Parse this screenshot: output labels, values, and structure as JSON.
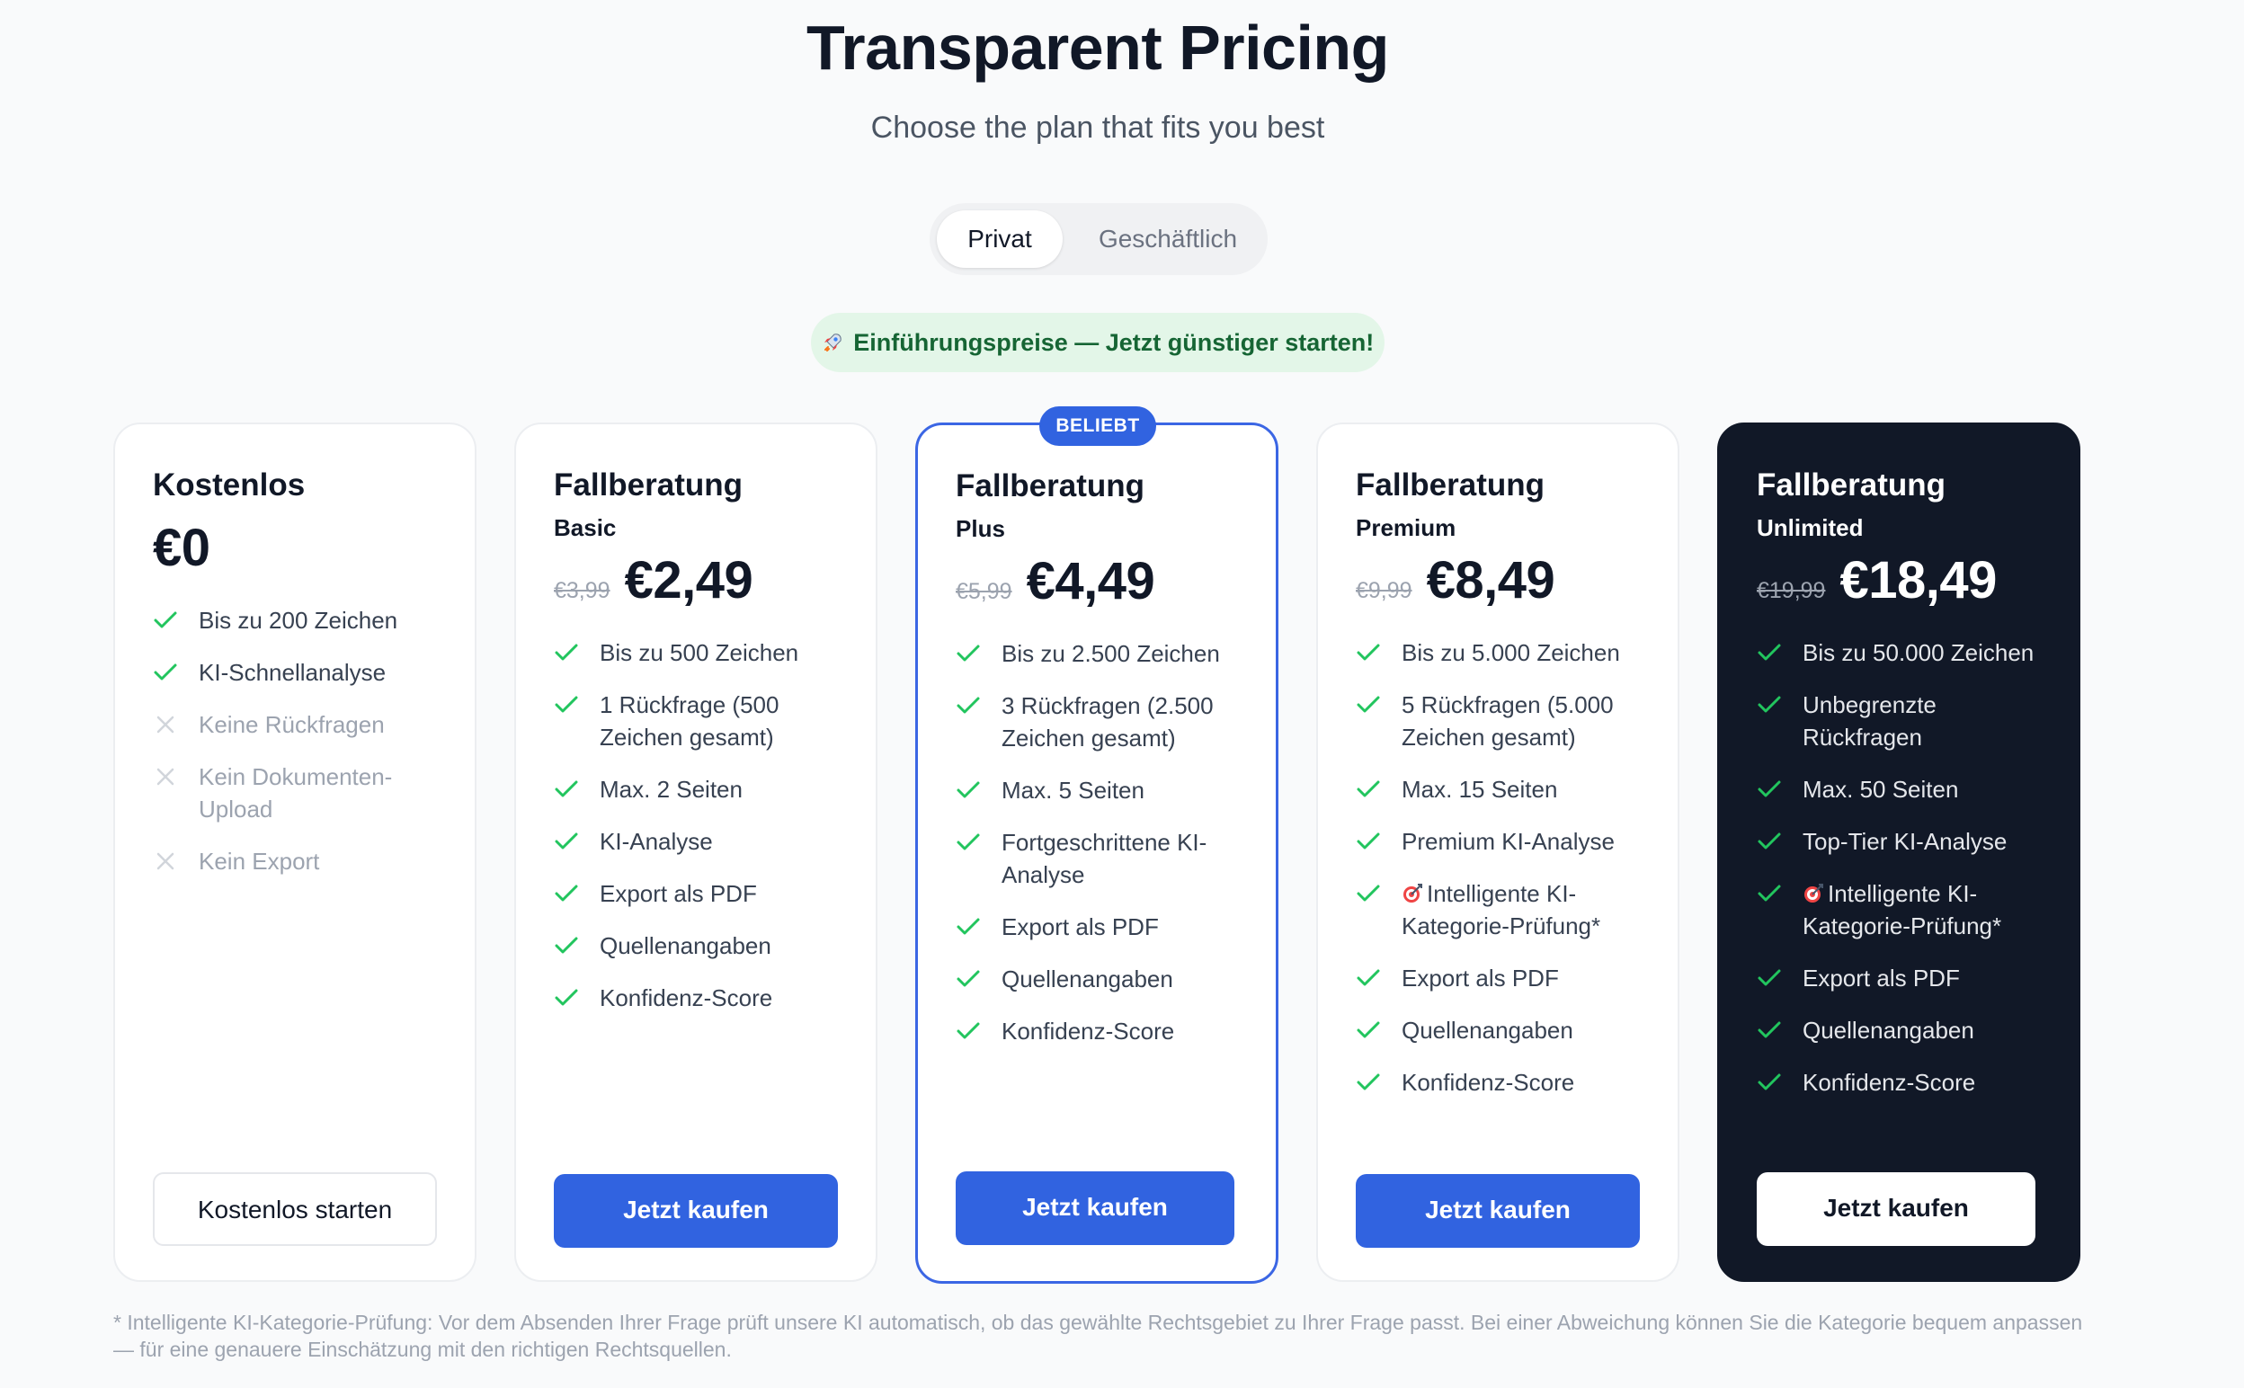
{
  "header": {
    "title": "Transparent Pricing",
    "subtitle": "Choose the plan that fits you best"
  },
  "toggle": {
    "active": "Privat",
    "inactive": "Geschäftlich"
  },
  "promo": {
    "icon": "rocket-icon",
    "text": "Einführungspreise — Jetzt günstiger starten!"
  },
  "colors": {
    "accent": "#3163e0",
    "check": "#22c55e",
    "promo_bg": "#e3f6e8",
    "dark_card": "#111827"
  },
  "plans": [
    {
      "name": "Kostenlos",
      "tier": "",
      "old_price": "",
      "price": "€0",
      "features": [
        {
          "text": "Bis zu 200 Zeichen",
          "included": true
        },
        {
          "text": "KI-Schnellanalyse",
          "included": true
        },
        {
          "text": "Keine Rückfragen",
          "included": false
        },
        {
          "text": "Kein Dokumenten-Upload",
          "included": false
        },
        {
          "text": "Kein Export",
          "included": false
        }
      ],
      "button": "Kostenlos starten"
    },
    {
      "name": "Fallberatung",
      "tier": "Basic",
      "old_price": "€3,99",
      "price": "€2,49",
      "features": [
        {
          "text": "Bis zu 500 Zeichen",
          "included": true
        },
        {
          "text": "1 Rückfrage (500 Zeichen gesamt)",
          "included": true
        },
        {
          "text": "Max. 2 Seiten",
          "included": true
        },
        {
          "text": "KI-Analyse",
          "included": true
        },
        {
          "text": "Export als PDF",
          "included": true
        },
        {
          "text": "Quellenangaben",
          "included": true
        },
        {
          "text": "Konfidenz-Score",
          "included": true
        }
      ],
      "button": "Jetzt kaufen"
    },
    {
      "name": "Fallberatung",
      "tier": "Plus",
      "old_price": "€5,99",
      "price": "€4,49",
      "badge": "BELIEBT",
      "features": [
        {
          "text": "Bis zu 2.500 Zeichen",
          "included": true
        },
        {
          "text": "3 Rückfragen (2.500 Zeichen gesamt)",
          "included": true
        },
        {
          "text": "Max. 5 Seiten",
          "included": true
        },
        {
          "text": "Fortgeschrittene KI-Analyse",
          "included": true
        },
        {
          "text": "Export als PDF",
          "included": true
        },
        {
          "text": "Quellenangaben",
          "included": true
        },
        {
          "text": "Konfidenz-Score",
          "included": true
        }
      ],
      "button": "Jetzt kaufen"
    },
    {
      "name": "Fallberatung",
      "tier": "Premium",
      "old_price": "€9,99",
      "price": "€8,49",
      "features": [
        {
          "text": "Bis zu 5.000 Zeichen",
          "included": true
        },
        {
          "text": "5 Rückfragen (5.000 Zeichen gesamt)",
          "included": true
        },
        {
          "text": "Max. 15 Seiten",
          "included": true
        },
        {
          "text": "Premium KI-Analyse",
          "included": true
        },
        {
          "text": "Intelligente KI-Kategorie-Prüfung*",
          "included": true,
          "icon": "target-icon"
        },
        {
          "text": "Export als PDF",
          "included": true
        },
        {
          "text": "Quellenangaben",
          "included": true
        },
        {
          "text": "Konfidenz-Score",
          "included": true
        }
      ],
      "button": "Jetzt kaufen"
    },
    {
      "name": "Fallberatung",
      "tier": "Unlimited",
      "old_price": "€19,99",
      "price": "€18,49",
      "features": [
        {
          "text": "Bis zu 50.000 Zeichen",
          "included": true
        },
        {
          "text": "Unbegrenzte Rückfragen",
          "included": true
        },
        {
          "text": "Max. 50 Seiten",
          "included": true
        },
        {
          "text": "Top-Tier KI-Analyse",
          "included": true
        },
        {
          "text": "Intelligente KI-Kategorie-Prüfung*",
          "included": true,
          "icon": "target-icon"
        },
        {
          "text": "Export als PDF",
          "included": true
        },
        {
          "text": "Quellenangaben",
          "included": true
        },
        {
          "text": "Konfidenz-Score",
          "included": true
        }
      ],
      "button": "Jetzt kaufen"
    }
  ],
  "footnote": "* Intelligente KI-Kategorie-Prüfung: Vor dem Absenden Ihrer Frage prüft unsere KI automatisch, ob das gewählte Rechtsgebiet zu Ihrer Frage passt. Bei einer Abweichung können Sie die Kategorie bequem anpassen — für eine genauere Einschätzung mit den richtigen Rechtsquellen."
}
